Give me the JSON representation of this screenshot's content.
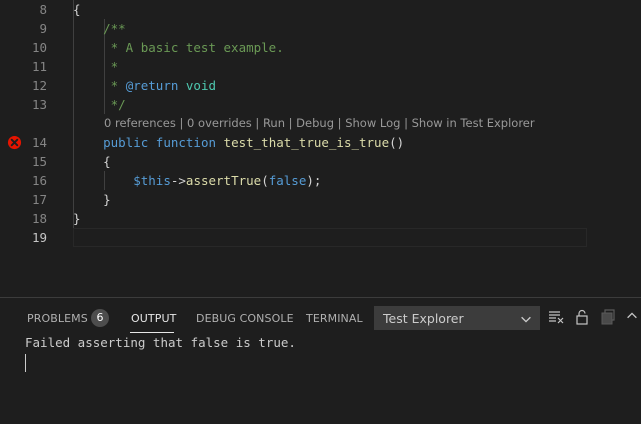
{
  "editor": {
    "lines": [
      {
        "number": "8",
        "segments": [
          {
            "t": "{",
            "c": "#d4d4d4"
          }
        ]
      },
      {
        "number": "9",
        "segments": [
          {
            "t": "    /**",
            "c": "#6a9955"
          }
        ]
      },
      {
        "number": "10",
        "segments": [
          {
            "t": "     * A basic test example.",
            "c": "#6a9955"
          }
        ]
      },
      {
        "number": "11",
        "segments": [
          {
            "t": "     *",
            "c": "#6a9955"
          }
        ]
      },
      {
        "number": "12",
        "segments": [
          {
            "t": "     * ",
            "c": "#6a9955"
          },
          {
            "t": "@return",
            "c": "#569cd6"
          },
          {
            "t": " ",
            "c": "#6a9955"
          },
          {
            "t": "void",
            "c": "#4ec9b0"
          }
        ]
      },
      {
        "number": "13",
        "segments": [
          {
            "t": "     */",
            "c": "#6a9955"
          }
        ]
      },
      {
        "number": "14",
        "segments": [
          {
            "t": "    ",
            "c": "#d4d4d4"
          },
          {
            "t": "public",
            "c": "#569cd6"
          },
          {
            "t": " ",
            "c": "#d4d4d4"
          },
          {
            "t": "function",
            "c": "#569cd6"
          },
          {
            "t": " ",
            "c": "#d4d4d4"
          },
          {
            "t": "test_that_true_is_true",
            "c": "#dcdcaa"
          },
          {
            "t": "()",
            "c": "#d4d4d4"
          }
        ]
      },
      {
        "number": "15",
        "segments": [
          {
            "t": "    {",
            "c": "#d4d4d4"
          }
        ]
      },
      {
        "number": "16",
        "segments": [
          {
            "t": "        ",
            "c": "#d4d4d4"
          },
          {
            "t": "$this",
            "c": "#569cd6"
          },
          {
            "t": "->",
            "c": "#d4d4d4"
          },
          {
            "t": "assertTrue",
            "c": "#dcdcaa"
          },
          {
            "t": "(",
            "c": "#d4d4d4"
          },
          {
            "t": "false",
            "c": "#569cd6"
          },
          {
            "t": ");",
            "c": "#d4d4d4"
          }
        ]
      },
      {
        "number": "17",
        "segments": [
          {
            "t": "    }",
            "c": "#d4d4d4"
          }
        ]
      },
      {
        "number": "18",
        "segments": [
          {
            "t": "}",
            "c": "#d4d4d4"
          }
        ]
      },
      {
        "number": "19",
        "segments": []
      }
    ],
    "codelens": "0 references | 0 overrides | Run | Debug | Show Log | Show in Test Explorer",
    "error_line": "14"
  },
  "panel": {
    "tabs": {
      "problems": "PROBLEMS",
      "problems_count": "6",
      "output": "OUTPUT",
      "debug_console": "DEBUG CONSOLE",
      "terminal": "TERMINAL"
    },
    "output_channel": "Test Explorer",
    "output_text": "Failed asserting that false is true."
  },
  "colors": {
    "error": "#e51400",
    "background": "#1e1e1e",
    "line_number": "#858585"
  }
}
